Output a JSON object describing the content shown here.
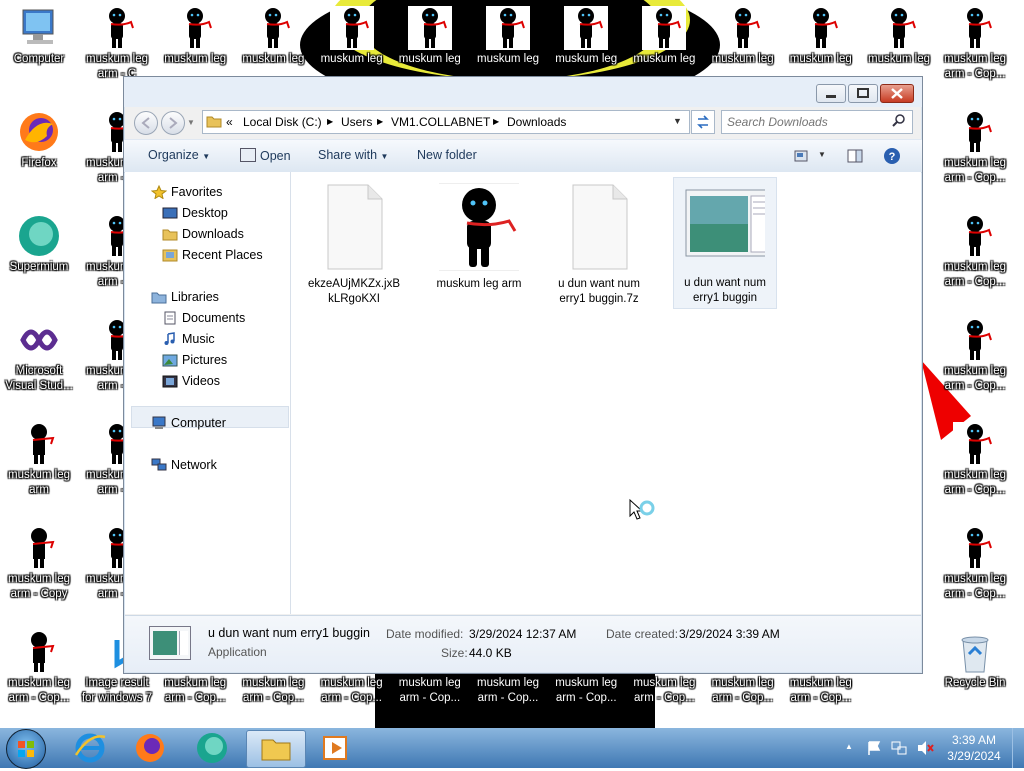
{
  "desktop": {
    "left_icons": [
      {
        "label": "Computer",
        "icon": "computer-icon"
      },
      {
        "label": "Firefox",
        "icon": "firefox-icon"
      },
      {
        "label": "Supermium",
        "icon": "supermium-icon"
      },
      {
        "label": "Microsoft Visual Stud...",
        "icon": "visual-studio-icon"
      },
      {
        "label": "muskum leg arm",
        "icon": "stick-figure-icon"
      },
      {
        "label": "muskum leg arm - Copy",
        "icon": "stick-figure-icon"
      },
      {
        "label": "muskum leg arm - Cop...",
        "icon": "stick-figure-icon"
      }
    ],
    "top_labels": [
      "muskum leg arm - C",
      "muskum leg",
      "muskum leg",
      "muskum leg",
      "muskum leg",
      "muskum leg",
      "muskum leg",
      "muskum leg",
      "muskum leg",
      "muskum leg",
      "muskum leg",
      "muskum leg arm - Cop...",
      "arm - Cop..."
    ],
    "right_labels": [
      "muskum leg arm - Cop...",
      "muskum leg arm - Cop...",
      "muskum leg arm - Cop...",
      "muskum leg arm - Cop...",
      "muskum leg arm - Cop...",
      "muskum leg arm - Cop..."
    ],
    "bottom_labels": [
      "Image result for windows 7",
      "muskum leg arm - Cop...",
      "muskum leg arm - Cop...",
      "muskum leg arm - Cop...",
      "muskum leg arm - Cop...",
      "muskum leg arm - Cop...",
      "muskum leg arm - Cop...",
      "muskum leg arm - Cop...",
      "muskum leg arm - Cop...",
      "muskum leg arm - Cop...",
      "muskum leg arm - Cop..."
    ],
    "recycle_bin": "Recycle Bin",
    "col2_label": "muskum leg arm - C"
  },
  "window": {
    "breadcrumb": [
      "«",
      "Local Disk (C:)",
      "VM1.COLLABNET",
      "Downloads"
    ],
    "breadcrumb_users": "Users",
    "search_placeholder": "Search Downloads",
    "toolbar": {
      "organize": "Organize",
      "open": "Open",
      "share_with": "Share with",
      "new_folder": "New folder"
    },
    "nav": {
      "favorites": "Favorites",
      "desktop": "Desktop",
      "downloads": "Downloads",
      "recent_places": "Recent Places",
      "libraries": "Libraries",
      "documents": "Documents",
      "music": "Music",
      "pictures": "Pictures",
      "videos": "Videos",
      "computer": "Computer",
      "network": "Network"
    },
    "files": [
      {
        "name": "ekzeAUjMKZx.jxBkLRgoKXI",
        "line1": "ekzeAUjMKZx.jxB",
        "line2": "kLRgoKXI"
      },
      {
        "name": "muskum leg arm",
        "line1": "muskum leg arm",
        "line2": ""
      },
      {
        "name": "u dun want num erry1 buggin.7z",
        "line1": "u dun want num",
        "line2": "erry1 buggin.7z"
      },
      {
        "name": "u dun want num erry1 buggin",
        "line1": "u dun want num",
        "line2": "erry1 buggin"
      }
    ],
    "details": {
      "name": "u dun want num erry1 buggin",
      "type": "Application",
      "modified_label": "Date modified:",
      "modified": "3/29/2024 12:37 AM",
      "created_label": "Date created:",
      "created": "3/29/2024 3:39 AM",
      "size_label": "Size:",
      "size": "44.0 KB"
    }
  },
  "taskbar": {
    "time": "3:39 AM",
    "date": "3/29/2024"
  },
  "colors": {
    "taskbar": "#3f78b3",
    "accent": "#1e395b",
    "selection": "#dbe6f4"
  }
}
